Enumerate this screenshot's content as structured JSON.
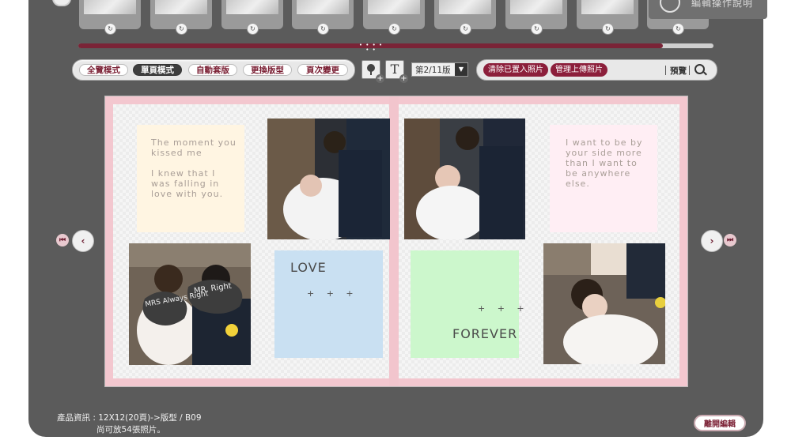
{
  "help": {
    "label": "編輯操作說明"
  },
  "thumbnails": [
    {
      "name": "thumb-1"
    },
    {
      "name": "thumb-2"
    },
    {
      "name": "thumb-3"
    },
    {
      "name": "thumb-4"
    },
    {
      "name": "thumb-5"
    },
    {
      "name": "thumb-6"
    },
    {
      "name": "thumb-7"
    },
    {
      "name": "thumb-8"
    },
    {
      "name": "thumb-9"
    }
  ],
  "thumb_progress": 0.92,
  "modes": {
    "full": "全覽模式",
    "single": "單頁模式",
    "auto": "自動套版",
    "change_layout": "更換版型",
    "page_change": "頁次變更"
  },
  "tools": {
    "bg_icon": "tree-background-icon",
    "text_icon": "text-add-icon",
    "text_glyph": "T"
  },
  "page_select": {
    "value": "第2/11版"
  },
  "actions": {
    "clear": "清除已置入照片",
    "manage": "管理上傳照片",
    "preview": "預覽"
  },
  "album": {
    "left_text": "The moment you\nkissed me\n\nI knew that I\nwas falling in\nlove with you.",
    "right_text": "I want to be by\nyour side more\nthan I want to\nbe anywhere\nelse.",
    "love_label": "LOVE",
    "love_plus": "+ + +",
    "forever_label": "FOREVER",
    "forever_plus": "+ + +",
    "sign_left": "MRS Always Right",
    "sign_right": "MR. Right"
  },
  "colors": {
    "accent": "#8c1f3b",
    "panel": "#5b5b5b",
    "cream": "#fff5e2",
    "pink_box": "#ffeef4",
    "blue_box": "#c9e0f2",
    "green_box": "#ccf7cc"
  },
  "footer": {
    "product_info": "產品資訊 : 12X12(20頁)->版型 / B09",
    "capacity": "尚可放54張照片。",
    "leave": "離開編輯"
  }
}
